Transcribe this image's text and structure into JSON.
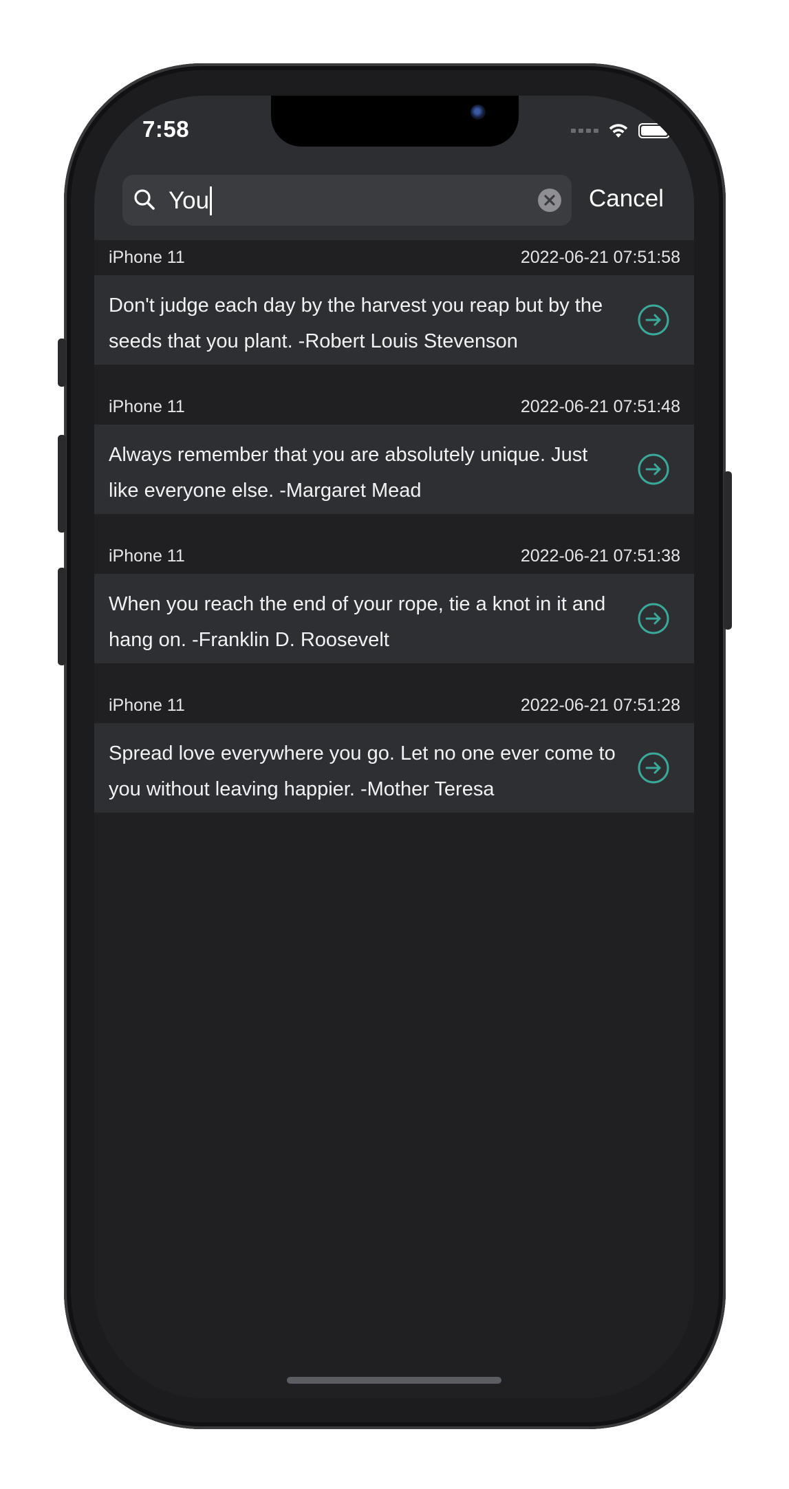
{
  "status_bar": {
    "time": "7:58"
  },
  "search": {
    "value": "You",
    "cancel_label": "Cancel"
  },
  "colors": {
    "accent": "#3aa99a",
    "background": "#202023",
    "row_background": "#2e2f33"
  },
  "results": [
    {
      "device": "iPhone 11",
      "timestamp": "2022-06-21 07:51:58",
      "quote": "Don't judge each day by the harvest you reap but by the seeds that you plant. -Robert Louis Stevenson"
    },
    {
      "device": "iPhone 11",
      "timestamp": "2022-06-21 07:51:48",
      "quote": "Always remember that you are absolutely unique. Just like everyone else. -Margaret Mead"
    },
    {
      "device": "iPhone 11",
      "timestamp": "2022-06-21 07:51:38",
      "quote": "When you reach the end of your rope, tie a knot in it and hang on. -Franklin D. Roosevelt"
    },
    {
      "device": "iPhone 11",
      "timestamp": "2022-06-21 07:51:28",
      "quote": "Spread love everywhere you go. Let no one ever come to you without leaving happier. -Mother Teresa"
    }
  ],
  "icons": {
    "search": "search-icon",
    "clear": "clear-icon",
    "row_action": "arrow-right-circle-icon",
    "wifi": "wifi-icon",
    "battery": "battery-icon",
    "signal": "signal-icon"
  }
}
